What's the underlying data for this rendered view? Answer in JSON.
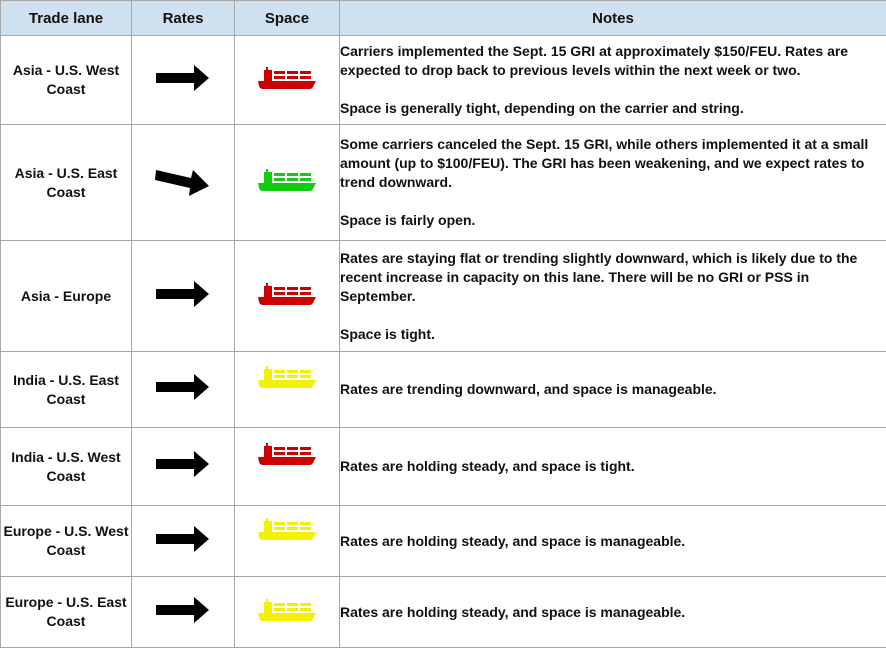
{
  "table": {
    "headers": {
      "trade_lane": "Trade lane",
      "rates": "Rates",
      "space": "Space",
      "notes": "Notes"
    },
    "legend_colors": {
      "tight": "#cc0000",
      "open": "#11cc11",
      "manageable": "#f2f200"
    },
    "rows": [
      {
        "lane": "Asia - U.S. West Coast",
        "rate_trend": "flat",
        "rate_icon": "arrow-right-icon",
        "space_status": "tight",
        "space_icon": "ship-icon",
        "space_color": "#cc0000",
        "notes": [
          "Carriers implemented the Sept. 15 GRI at approximately $150/FEU. Rates are expected to drop back to previous levels within the next week or two.",
          "Space is generally tight, depending on the carrier and string."
        ]
      },
      {
        "lane": "Asia - U.S. East Coast",
        "rate_trend": "down",
        "rate_icon": "arrow-down-right-icon",
        "space_status": "open",
        "space_icon": "ship-icon",
        "space_color": "#11cc11",
        "notes": [
          "Some carriers canceled the Sept. 15 GRI, while others implemented it at a small amount (up to $100/FEU). The GRI has been weakening, and we expect rates to trend downward.",
          "Space is fairly open."
        ]
      },
      {
        "lane": "Asia - Europe",
        "rate_trend": "flat",
        "rate_icon": "arrow-right-icon",
        "space_status": "tight",
        "space_icon": "ship-icon",
        "space_color": "#cc0000",
        "notes": [
          "Rates are staying flat or trending slightly downward, which is likely due to the recent increase in capacity on this lane. There will be no GRI or PSS in September.",
          "Space is tight."
        ]
      },
      {
        "lane": "India - U.S. East Coast",
        "rate_trend": "flat",
        "rate_icon": "arrow-right-icon",
        "space_status": "manageable",
        "space_icon": "ship-icon",
        "space_color": "#f2f200",
        "notes": [
          "Rates are trending downward, and space is manageable."
        ]
      },
      {
        "lane": "India - U.S. West Coast",
        "rate_trend": "flat",
        "rate_icon": "arrow-right-icon",
        "space_status": "tight",
        "space_icon": "ship-icon",
        "space_color": "#cc0000",
        "notes": [
          "Rates are holding steady, and space is tight."
        ]
      },
      {
        "lane": "Europe - U.S. West Coast",
        "rate_trend": "flat",
        "rate_icon": "arrow-right-icon",
        "space_status": "manageable",
        "space_icon": "ship-icon",
        "space_color": "#f2f200",
        "notes": [
          "Rates are holding steady, and space is manageable."
        ]
      },
      {
        "lane": "Europe - U.S. East Coast",
        "rate_trend": "flat",
        "rate_icon": "arrow-right-icon",
        "space_status": "manageable",
        "space_icon": "ship-icon",
        "space_color": "#f2f200",
        "notes": [
          "Rates are holding steady, and space is manageable."
        ]
      }
    ]
  }
}
